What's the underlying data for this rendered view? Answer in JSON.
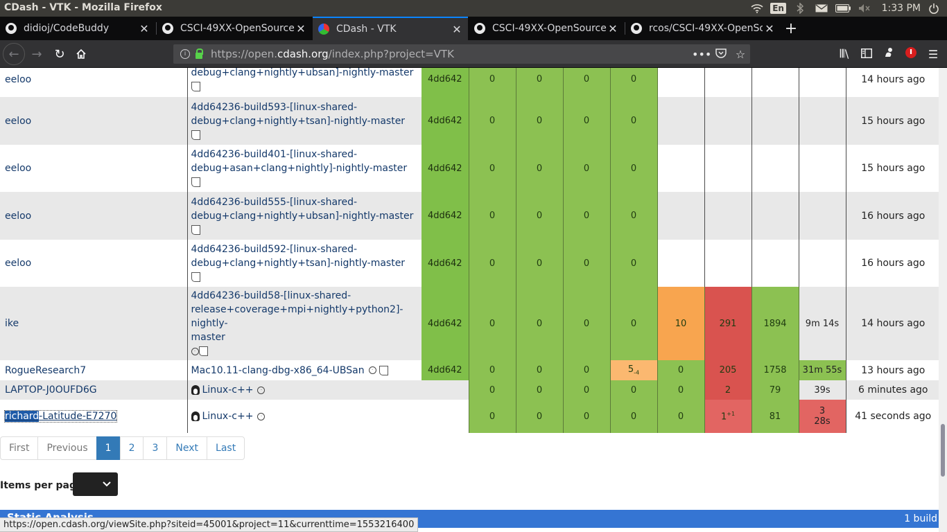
{
  "os_bar": {
    "window_title": "CDash - VTK - Mozilla Firefox",
    "keyboard_layout": "En",
    "clock": "1:33 PM",
    "icons": [
      "wifi-icon",
      "bluetooth-icon",
      "mail-icon",
      "battery-icon",
      "volume-muted-icon",
      "power-icon"
    ]
  },
  "tabs": [
    {
      "title": "didioj/CodeBuddy",
      "favicon": "github-icon"
    },
    {
      "title": "CSCI-49XX-OpenSource/",
      "favicon": "github-icon"
    },
    {
      "title": "CDash - VTK",
      "favicon": "cdash-icon",
      "active": true
    },
    {
      "title": "CSCI-49XX-OpenSource/",
      "favicon": "github-icon"
    },
    {
      "title": "rcos/CSCI-49XX-OpenSou",
      "favicon": "github-icon"
    }
  ],
  "navbar": {
    "url_prefix": "https://open.",
    "url_domain": "cdash.org",
    "url_path": "/index.php?project=VTK"
  },
  "builds": [
    {
      "site": "eeloo",
      "name_lines": [
        "debug+clang+nightly+ubsan]-nightly-master"
      ],
      "has_note": true,
      "revision": "4dd642",
      "cfg_err": "0",
      "cfg_warn": "0",
      "bld_err": "0",
      "bld_warn": "0",
      "test_notrun": "",
      "test_fail": "",
      "test_pass": "",
      "test_time": "",
      "start": "14 hours ago",
      "row": "white"
    },
    {
      "site": "eeloo",
      "name_lines": [
        "4dd64236-build593-[linux-shared-",
        "debug+clang+nightly+tsan]-nightly-master"
      ],
      "has_note": true,
      "revision": "4dd642",
      "cfg_err": "0",
      "cfg_warn": "0",
      "bld_err": "0",
      "bld_warn": "0",
      "test_notrun": "",
      "test_fail": "",
      "test_pass": "",
      "test_time": "",
      "start": "15 hours ago",
      "row": "gray"
    },
    {
      "site": "eeloo",
      "name_lines": [
        "4dd64236-build401-[linux-shared-",
        "debug+asan+clang+nightly]-nightly-master"
      ],
      "has_note": true,
      "revision": "4dd642",
      "cfg_err": "0",
      "cfg_warn": "0",
      "bld_err": "0",
      "bld_warn": "0",
      "test_notrun": "",
      "test_fail": "",
      "test_pass": "",
      "test_time": "",
      "start": "15 hours ago",
      "row": "white"
    },
    {
      "site": "eeloo",
      "name_lines": [
        "4dd64236-build555-[linux-shared-",
        "debug+clang+nightly+ubsan]-nightly-master"
      ],
      "has_note": true,
      "revision": "4dd642",
      "cfg_err": "0",
      "cfg_warn": "0",
      "bld_err": "0",
      "bld_warn": "0",
      "test_notrun": "",
      "test_fail": "",
      "test_pass": "",
      "test_time": "",
      "start": "16 hours ago",
      "row": "gray"
    },
    {
      "site": "eeloo",
      "name_lines": [
        "4dd64236-build592-[linux-shared-",
        "debug+clang+nightly+tsan]-nightly-master"
      ],
      "has_note": true,
      "revision": "4dd642",
      "cfg_err": "0",
      "cfg_warn": "0",
      "bld_err": "0",
      "bld_warn": "0",
      "test_notrun": "",
      "test_fail": "",
      "test_pass": "",
      "test_time": "",
      "start": "16 hours ago",
      "row": "white"
    },
    {
      "site": "ike",
      "name_lines": [
        "4dd64236-build58-[linux-shared-",
        "release+coverage+mpi+nightly+python2]-nightly-",
        "master"
      ],
      "has_note": true,
      "revision": "4dd642",
      "cfg_err": "0",
      "cfg_warn": "0",
      "bld_err": "0",
      "bld_warn": "0",
      "test_notrun": "10",
      "test_fail": "291",
      "test_pass": "1894",
      "test_time": "9m 14s",
      "start": "14 hours ago",
      "row": "gray"
    },
    {
      "site": "RogueResearch7",
      "name_lines": [
        "Mac10.11-clang-dbg-x86_64-UBSan"
      ],
      "has_note": true,
      "revision": "4dd642",
      "cfg_err": "0",
      "cfg_warn": "0",
      "bld_err": "0",
      "bld_warn": "5",
      "bld_warn_delta": "-4",
      "test_notrun": "0",
      "test_fail": "205",
      "test_pass": "1758",
      "test_time": "31m 55s",
      "start": "13 hours ago",
      "row": "white"
    },
    {
      "site": "LAPTOP-J0OUFD6G",
      "name_lines": [
        "Linux-c++"
      ],
      "has_note": false,
      "revision": "",
      "cfg_err": "0",
      "cfg_warn": "0",
      "bld_err": "0",
      "bld_warn": "0",
      "test_notrun": "0",
      "test_fail": "2",
      "test_pass": "79",
      "test_time": "39s",
      "start": "6 minutes ago",
      "row": "gray"
    },
    {
      "site_highlight": "richard",
      "site_rest": "-Latitude-E7270",
      "site": "richard-Latitude-E7270",
      "name_lines": [
        "Linux-c++"
      ],
      "has_note": false,
      "revision": "",
      "cfg_err": "0",
      "cfg_warn": "0",
      "bld_err": "0",
      "bld_warn": "0",
      "test_notrun": "0",
      "test_fail": "1",
      "test_fail_delta": "+1",
      "test_pass": "81",
      "test_time_lines": [
        "3",
        "28s"
      ],
      "test_time": "3 28s",
      "start": "41 seconds ago",
      "row": "white"
    }
  ],
  "pagination": {
    "first": "First",
    "previous": "Previous",
    "pages": [
      "1",
      "2",
      "3"
    ],
    "current": "1",
    "next": "Next",
    "last": "Last"
  },
  "items_per_page": {
    "label": "Items per page",
    "value": ""
  },
  "static_analysis": {
    "title": "Static Analysis",
    "count": "1 build"
  },
  "status_url": "https://open.cdash.org/viewSite.php?siteid=45001&project=11&currenttime=1553216400",
  "colors": {
    "pass_green": "#8cc152",
    "fail_red": "#d9534f",
    "warn_orange": "#f8a54f",
    "header_blue": "#3575d3",
    "link": "#337ab7"
  }
}
